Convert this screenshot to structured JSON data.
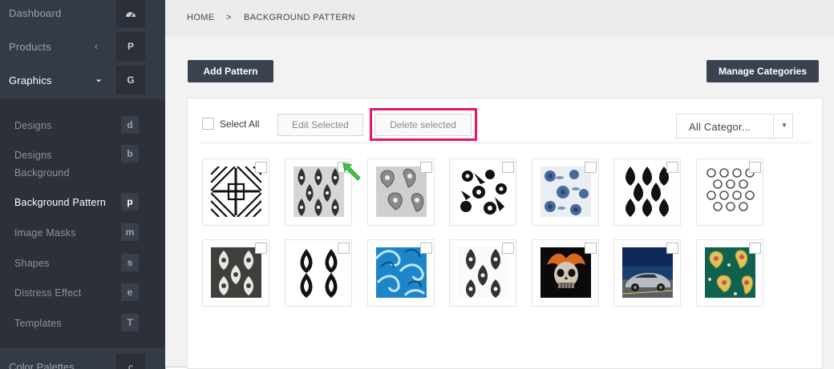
{
  "sidebar": {
    "items": [
      {
        "label": "Dashboard",
        "badge": "",
        "icon": "dashboard-icon"
      },
      {
        "label": "Products",
        "badge": "P",
        "chevron": "‹"
      },
      {
        "label": "Graphics",
        "badge": "G",
        "chevron": "⌄"
      }
    ],
    "sub_items": [
      {
        "label": "Designs",
        "badge": "d"
      },
      {
        "label": "Designs Background",
        "badge": "b"
      },
      {
        "label": "Background Pattern",
        "badge": "p"
      },
      {
        "label": "Image Masks",
        "badge": "m"
      },
      {
        "label": "Shapes",
        "badge": "s"
      },
      {
        "label": "Distress Effect",
        "badge": "e"
      },
      {
        "label": "Templates",
        "badge": "T"
      }
    ],
    "bottom_label": "Color Palettes",
    "bottom_badge": "c"
  },
  "breadcrumb": {
    "home": "HOME",
    "separator": ">",
    "current": "BACKGROUND PATTERN"
  },
  "actions": {
    "add_label": "Add Pattern",
    "manage_label": "Manage Categories"
  },
  "toolbar": {
    "select_all": "Select All",
    "edit_selected": "Edit Selected",
    "delete_selected": "Delete selected",
    "category_value": "All Categor..."
  },
  "colors": {
    "sidebar_bg": "#2b3039",
    "highlight": "#e8156b",
    "button_dark": "#3a4250",
    "arrow": "#3cc84a"
  },
  "patterns": [
    {
      "name": "pattern-geometric"
    },
    {
      "name": "pattern-damask-grey"
    },
    {
      "name": "pattern-paisley-grey"
    },
    {
      "name": "pattern-floral-black"
    },
    {
      "name": "pattern-floral-blue"
    },
    {
      "name": "pattern-damask-black"
    },
    {
      "name": "pattern-ornament-grey"
    },
    {
      "name": "pattern-damask-dark"
    },
    {
      "name": "pattern-damask-bw"
    },
    {
      "name": "pattern-waves-blue"
    },
    {
      "name": "pattern-damask-white"
    },
    {
      "name": "pattern-skull"
    },
    {
      "name": "pattern-car"
    },
    {
      "name": "pattern-paisley-green"
    }
  ]
}
